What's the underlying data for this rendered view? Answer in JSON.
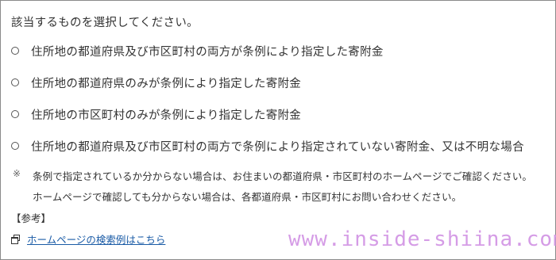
{
  "prompt": "該当するものを選択してください。",
  "options": [
    {
      "label": "住所地の都道府県及び市区町村の両方が条例により指定した寄附金"
    },
    {
      "label": "住所地の都道府県のみが条例により指定した寄附金"
    },
    {
      "label": "住所地の市区町村のみが条例により指定した寄附金"
    },
    {
      "label": "住所地の都道府県及び市区町村の両方で条例により指定されていない寄附金、又は不明な場合"
    }
  ],
  "note": {
    "mark": "※",
    "lines": [
      "条例で指定されているか分からない場合は、お住まいの都道府県・市区町村のホームページでご確認ください。",
      "ホームページで確認しても分からない場合は、各都道府県・市区町村にお問い合わせください。"
    ]
  },
  "reference": {
    "heading": "【参考】",
    "link_label": "ホームページの検索例はこちら",
    "icon": "new-window-icon"
  },
  "watermark": "www.inside-shiina.com",
  "colors": {
    "text": "#333333",
    "link": "#1a5ba6",
    "watermark": "#d59ce6",
    "border": "#8a8a8a"
  }
}
